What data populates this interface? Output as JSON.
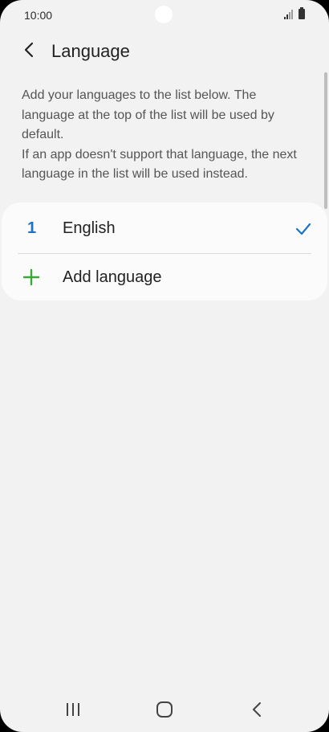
{
  "status_bar": {
    "time": "10:00",
    "icons": [
      "signal-icon",
      "battery-icon"
    ]
  },
  "header": {
    "back_icon": "chevron-left-icon",
    "title": "Language"
  },
  "description": {
    "line1": "Add your languages to the list below. The language at the top of the list will be used by default.",
    "line2": "If an app doesn't support that language, the next language in the list will be used instead."
  },
  "languages": [
    {
      "number": "1",
      "name": "English",
      "selected": true,
      "icon": "check-icon"
    }
  ],
  "add_language": {
    "label": "Add language",
    "icon": "plus-icon"
  },
  "nav_bar": {
    "items": [
      "recent-apps-icon",
      "home-icon",
      "back-icon"
    ]
  },
  "colors": {
    "background": "#f2f2f2",
    "card": "#fbfbfb",
    "accent_blue": "#1a73c9",
    "accent_green": "#3aa935",
    "text_primary": "#222222",
    "text_secondary": "#555555"
  }
}
